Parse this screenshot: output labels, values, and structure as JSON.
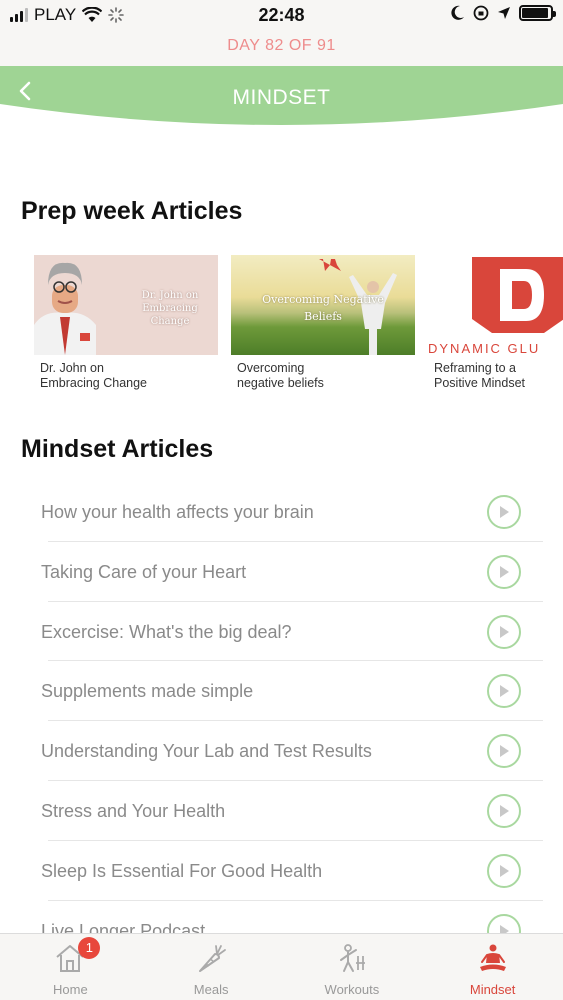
{
  "status_bar": {
    "carrier": "PLAY",
    "time": "22:48"
  },
  "day_bar": {
    "text": "DAY 82 OF 91"
  },
  "header": {
    "title": "MINDSET",
    "accent_color": "#9fd494"
  },
  "prep_section": {
    "title": "Prep week Articles",
    "cards": [
      {
        "thumb_text": "Dr. John on Embracing Change",
        "caption_line1": "Dr. John on",
        "caption_line2": "Embracing Change"
      },
      {
        "thumb_text_line1": "Overcoming Negative",
        "thumb_text_line2": "Beliefs",
        "caption_line1": "Overcoming",
        "caption_line2": "negative beliefs"
      },
      {
        "thumb_text": "DYNAMIC GLU",
        "caption_line1": "Reframing to a",
        "caption_line2": "Positive Mindset"
      }
    ]
  },
  "mindset_section": {
    "title": "Mindset Articles",
    "articles": [
      "How your health affects your brain",
      "Taking Care of your Heart",
      "Excercise: What's the big deal?",
      "Supplements made simple",
      "Understanding Your Lab and Test Results",
      "Stress and Your Health",
      "Sleep Is Essential For Good Health",
      "Live Longer Podcast"
    ]
  },
  "tab_bar": {
    "tabs": [
      {
        "label": "Home",
        "badge": "1"
      },
      {
        "label": "Meals"
      },
      {
        "label": "Workouts"
      },
      {
        "label": "Mindset"
      }
    ],
    "active_color": "#d9463b"
  }
}
